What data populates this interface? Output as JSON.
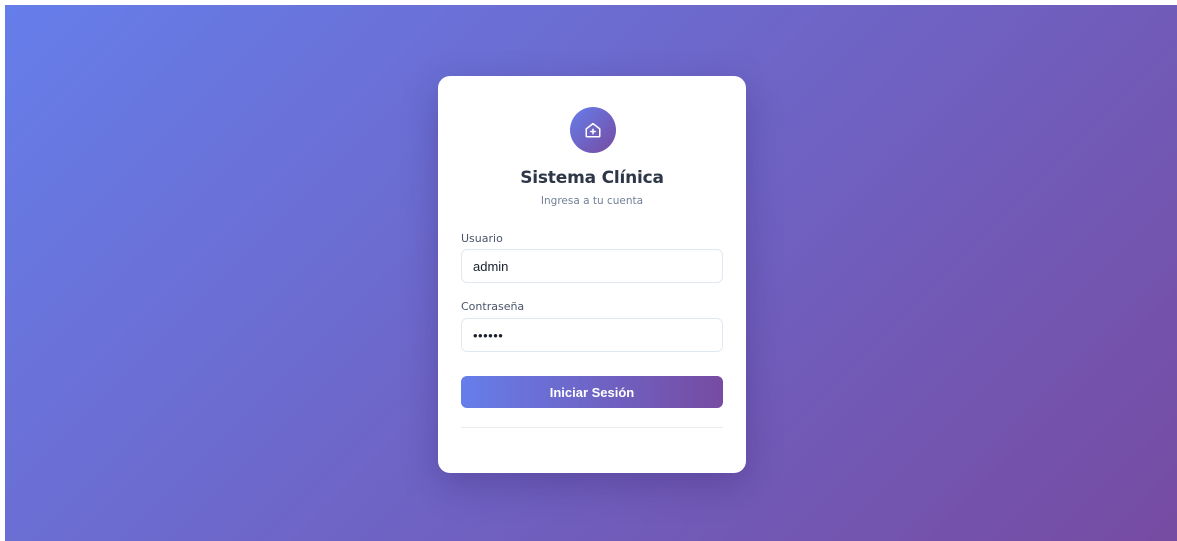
{
  "login": {
    "logo_icon": "hospital-home-icon",
    "title": "Sistema Clínica",
    "subtitle": "Ingresa a tu cuenta",
    "username": {
      "label": "Usuario",
      "value": "admin"
    },
    "password": {
      "label": "Contraseña",
      "value": "••••••"
    },
    "submit_label": "Iniciar Sesión"
  },
  "colors": {
    "gradient_start": "#667eea",
    "gradient_end": "#764ba2",
    "title": "#2d3748",
    "subtitle": "#718096",
    "card": "#ffffff"
  }
}
